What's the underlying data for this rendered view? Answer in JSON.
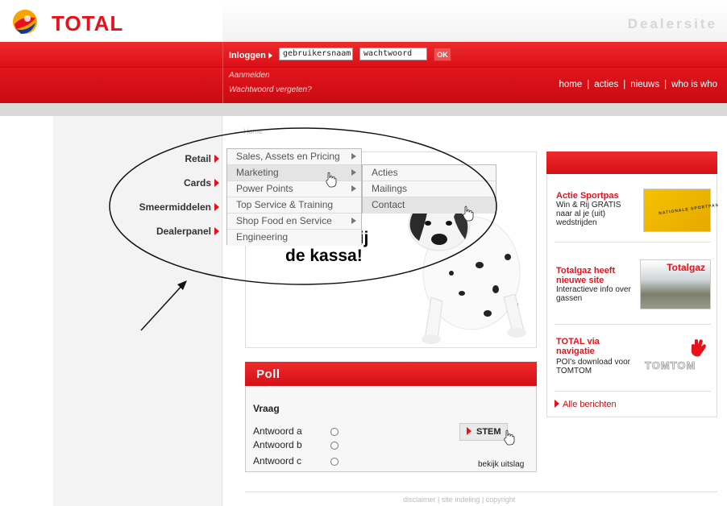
{
  "brand": {
    "logo_text": "TOTAL",
    "site_title": "Dealersite",
    "accent_color": "#e8111b"
  },
  "login": {
    "label": "Inloggen",
    "username_value": "gebruikersnaam",
    "password_value": "wachtwoord",
    "ok_label": "OK",
    "register_link": "Aanmelden",
    "forgot_link": "Wachtwoord vergeten?"
  },
  "top_nav": {
    "items": [
      "home",
      "acties",
      "nieuws",
      "who is who"
    ],
    "separator": "|"
  },
  "breadcrumb": "Home",
  "sidebar": {
    "items": [
      "Retail",
      "Cards",
      "Smeermiddelen",
      "Dealerpanel"
    ]
  },
  "dropdown": {
    "items": [
      "Sales, Assets en Pricing",
      "Marketing",
      "Power Points",
      "Top Service & Training",
      "Shop Food en Service",
      "Engineering"
    ],
    "submenu": [
      "Acties",
      "Mailings",
      "Contact"
    ]
  },
  "promo": {
    "line1": "e",
    "line2": "t bij",
    "line3": "de kassa!"
  },
  "poll": {
    "title": "Poll",
    "question": "Vraag",
    "answers": [
      "Antwoord a",
      "Antwoord b",
      "Antwoord c"
    ],
    "vote_label": "STEM",
    "results_link": "bekijk uitslag"
  },
  "news": {
    "items": [
      {
        "title": "Actie Sportpas",
        "body": "Win & Rij GRATIS naar al je (uit) wedstrijden",
        "image_text": "NATIONALE SPORTPAS"
      },
      {
        "title": "Totalgaz heeft nieuwe site",
        "body": "Interactieve info over gassen",
        "image_text": "Totalgaz"
      },
      {
        "title": "TOTAL via navigatie",
        "body": "POI's download voor TOMTOM",
        "image_text": "TOMTOM"
      }
    ],
    "all_link": "Alle berichten"
  },
  "footer": "disclaimer | site indeling | copyright"
}
